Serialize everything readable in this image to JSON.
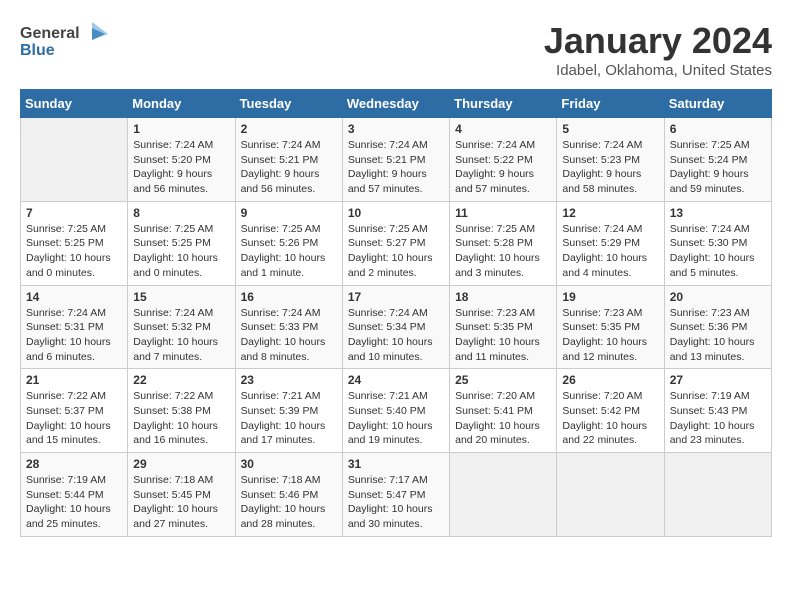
{
  "header": {
    "logo_general": "General",
    "logo_blue": "Blue",
    "title": "January 2024",
    "subtitle": "Idabel, Oklahoma, United States"
  },
  "calendar": {
    "days_of_week": [
      "Sunday",
      "Monday",
      "Tuesday",
      "Wednesday",
      "Thursday",
      "Friday",
      "Saturday"
    ],
    "weeks": [
      [
        {
          "day": "",
          "info": ""
        },
        {
          "day": "1",
          "info": "Sunrise: 7:24 AM\nSunset: 5:20 PM\nDaylight: 9 hours\nand 56 minutes."
        },
        {
          "day": "2",
          "info": "Sunrise: 7:24 AM\nSunset: 5:21 PM\nDaylight: 9 hours\nand 56 minutes."
        },
        {
          "day": "3",
          "info": "Sunrise: 7:24 AM\nSunset: 5:21 PM\nDaylight: 9 hours\nand 57 minutes."
        },
        {
          "day": "4",
          "info": "Sunrise: 7:24 AM\nSunset: 5:22 PM\nDaylight: 9 hours\nand 57 minutes."
        },
        {
          "day": "5",
          "info": "Sunrise: 7:24 AM\nSunset: 5:23 PM\nDaylight: 9 hours\nand 58 minutes."
        },
        {
          "day": "6",
          "info": "Sunrise: 7:25 AM\nSunset: 5:24 PM\nDaylight: 9 hours\nand 59 minutes."
        }
      ],
      [
        {
          "day": "7",
          "info": "Sunrise: 7:25 AM\nSunset: 5:25 PM\nDaylight: 10 hours\nand 0 minutes."
        },
        {
          "day": "8",
          "info": "Sunrise: 7:25 AM\nSunset: 5:25 PM\nDaylight: 10 hours\nand 0 minutes."
        },
        {
          "day": "9",
          "info": "Sunrise: 7:25 AM\nSunset: 5:26 PM\nDaylight: 10 hours\nand 1 minute."
        },
        {
          "day": "10",
          "info": "Sunrise: 7:25 AM\nSunset: 5:27 PM\nDaylight: 10 hours\nand 2 minutes."
        },
        {
          "day": "11",
          "info": "Sunrise: 7:25 AM\nSunset: 5:28 PM\nDaylight: 10 hours\nand 3 minutes."
        },
        {
          "day": "12",
          "info": "Sunrise: 7:24 AM\nSunset: 5:29 PM\nDaylight: 10 hours\nand 4 minutes."
        },
        {
          "day": "13",
          "info": "Sunrise: 7:24 AM\nSunset: 5:30 PM\nDaylight: 10 hours\nand 5 minutes."
        }
      ],
      [
        {
          "day": "14",
          "info": "Sunrise: 7:24 AM\nSunset: 5:31 PM\nDaylight: 10 hours\nand 6 minutes."
        },
        {
          "day": "15",
          "info": "Sunrise: 7:24 AM\nSunset: 5:32 PM\nDaylight: 10 hours\nand 7 minutes."
        },
        {
          "day": "16",
          "info": "Sunrise: 7:24 AM\nSunset: 5:33 PM\nDaylight: 10 hours\nand 8 minutes."
        },
        {
          "day": "17",
          "info": "Sunrise: 7:24 AM\nSunset: 5:34 PM\nDaylight: 10 hours\nand 10 minutes."
        },
        {
          "day": "18",
          "info": "Sunrise: 7:23 AM\nSunset: 5:35 PM\nDaylight: 10 hours\nand 11 minutes."
        },
        {
          "day": "19",
          "info": "Sunrise: 7:23 AM\nSunset: 5:35 PM\nDaylight: 10 hours\nand 12 minutes."
        },
        {
          "day": "20",
          "info": "Sunrise: 7:23 AM\nSunset: 5:36 PM\nDaylight: 10 hours\nand 13 minutes."
        }
      ],
      [
        {
          "day": "21",
          "info": "Sunrise: 7:22 AM\nSunset: 5:37 PM\nDaylight: 10 hours\nand 15 minutes."
        },
        {
          "day": "22",
          "info": "Sunrise: 7:22 AM\nSunset: 5:38 PM\nDaylight: 10 hours\nand 16 minutes."
        },
        {
          "day": "23",
          "info": "Sunrise: 7:21 AM\nSunset: 5:39 PM\nDaylight: 10 hours\nand 17 minutes."
        },
        {
          "day": "24",
          "info": "Sunrise: 7:21 AM\nSunset: 5:40 PM\nDaylight: 10 hours\nand 19 minutes."
        },
        {
          "day": "25",
          "info": "Sunrise: 7:20 AM\nSunset: 5:41 PM\nDaylight: 10 hours\nand 20 minutes."
        },
        {
          "day": "26",
          "info": "Sunrise: 7:20 AM\nSunset: 5:42 PM\nDaylight: 10 hours\nand 22 minutes."
        },
        {
          "day": "27",
          "info": "Sunrise: 7:19 AM\nSunset: 5:43 PM\nDaylight: 10 hours\nand 23 minutes."
        }
      ],
      [
        {
          "day": "28",
          "info": "Sunrise: 7:19 AM\nSunset: 5:44 PM\nDaylight: 10 hours\nand 25 minutes."
        },
        {
          "day": "29",
          "info": "Sunrise: 7:18 AM\nSunset: 5:45 PM\nDaylight: 10 hours\nand 27 minutes."
        },
        {
          "day": "30",
          "info": "Sunrise: 7:18 AM\nSunset: 5:46 PM\nDaylight: 10 hours\nand 28 minutes."
        },
        {
          "day": "31",
          "info": "Sunrise: 7:17 AM\nSunset: 5:47 PM\nDaylight: 10 hours\nand 30 minutes."
        },
        {
          "day": "",
          "info": ""
        },
        {
          "day": "",
          "info": ""
        },
        {
          "day": "",
          "info": ""
        }
      ]
    ]
  }
}
